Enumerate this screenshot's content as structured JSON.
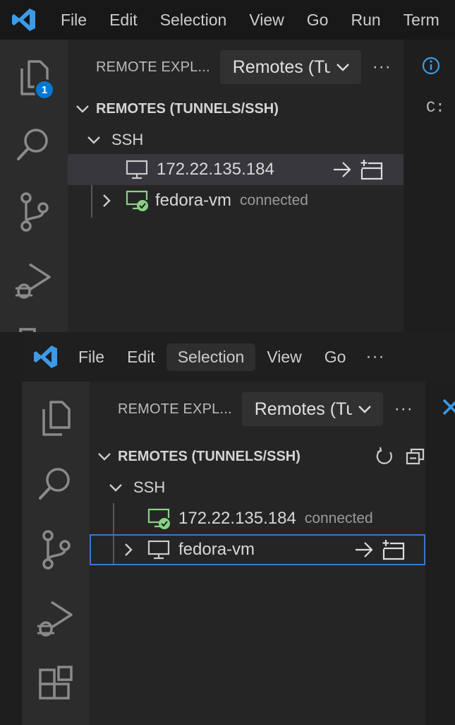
{
  "menu": {
    "back": [
      "File",
      "Edit",
      "Selection",
      "View",
      "Go",
      "Run",
      "Term"
    ],
    "front": [
      "File",
      "Edit",
      "Selection",
      "View",
      "Go"
    ],
    "more": "···"
  },
  "activity": {
    "explorer_badge": "1"
  },
  "sidebar": {
    "view_title": "REMOTE EXPL...",
    "remotes_dropdown": "Remotes (Tunnels/SSH)",
    "more": "···",
    "section": "REMOTES (TUNNELS/SSH)",
    "group": "SSH"
  },
  "back_window": {
    "hosts": [
      {
        "name": "172.22.135.184",
        "status": ""
      },
      {
        "name": "fedora-vm",
        "status": "connected"
      }
    ]
  },
  "front_window": {
    "hosts": [
      {
        "name": "172.22.135.184",
        "status": "connected"
      },
      {
        "name": "fedora-vm",
        "status": ""
      }
    ]
  },
  "editor_back": {
    "breadcrumb": "C:",
    "tab_icon": "info-icon"
  },
  "colors": {
    "accent": "#0078d4",
    "logo": "#3c9be8",
    "connected": "#89d185",
    "focus_border": "#3b77c9"
  }
}
